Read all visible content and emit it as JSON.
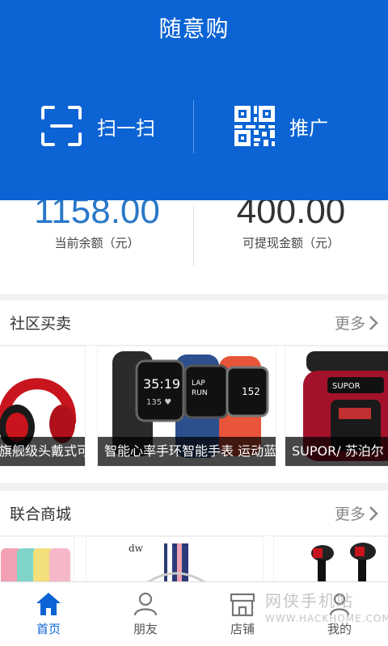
{
  "header": {
    "title": "随意购",
    "scan_label": "扫一扫",
    "promo_label": "推广"
  },
  "balance": {
    "current_value": "1158.00",
    "current_label": "当前余额（元）",
    "withdraw_value": "400.00",
    "withdraw_label": "可提现金额（元）"
  },
  "community": {
    "title": "社区买卖",
    "more": "更多",
    "items": [
      {
        "caption": "旗舰级头戴式可折"
      },
      {
        "caption": "智能心率手环智能手表 运动蓝"
      },
      {
        "caption": "SUPOR/ 苏泊尔"
      }
    ]
  },
  "mall": {
    "title": "联合商城",
    "more": "更多"
  },
  "tabs": [
    {
      "label": "首页"
    },
    {
      "label": "朋友"
    },
    {
      "label": "店铺"
    },
    {
      "label": "我的"
    }
  ],
  "watermark": {
    "top": "网侠手机站",
    "bottom": "WWW.HACKHOME.COM"
  },
  "colors": {
    "brand": "#0b63d4",
    "balance_value": "#2a78c8"
  }
}
